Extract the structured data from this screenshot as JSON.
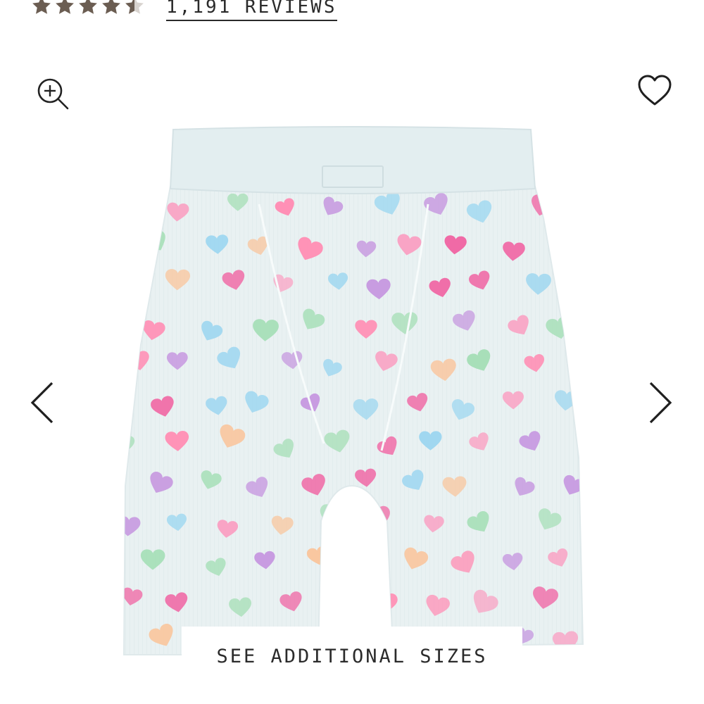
{
  "rating": {
    "stars": 4.5,
    "star_color": "#6b5d52",
    "reviews_label": "1,191 REVIEWS"
  },
  "icons": {
    "zoom": "zoom-in-icon",
    "favorite": "heart-outline-icon",
    "previous": "chevron-left-icon",
    "next": "chevron-right-icon"
  },
  "product_image": {
    "fabric_color": "#e9f1f2",
    "heart_colors": [
      "#f06aa6",
      "#f9a3c4",
      "#c79ae0",
      "#9fd7f0",
      "#a7dfb8",
      "#f9c7a0",
      "#ff8fb5"
    ]
  },
  "sizes_button": {
    "label": "SEE ADDITIONAL SIZES"
  }
}
